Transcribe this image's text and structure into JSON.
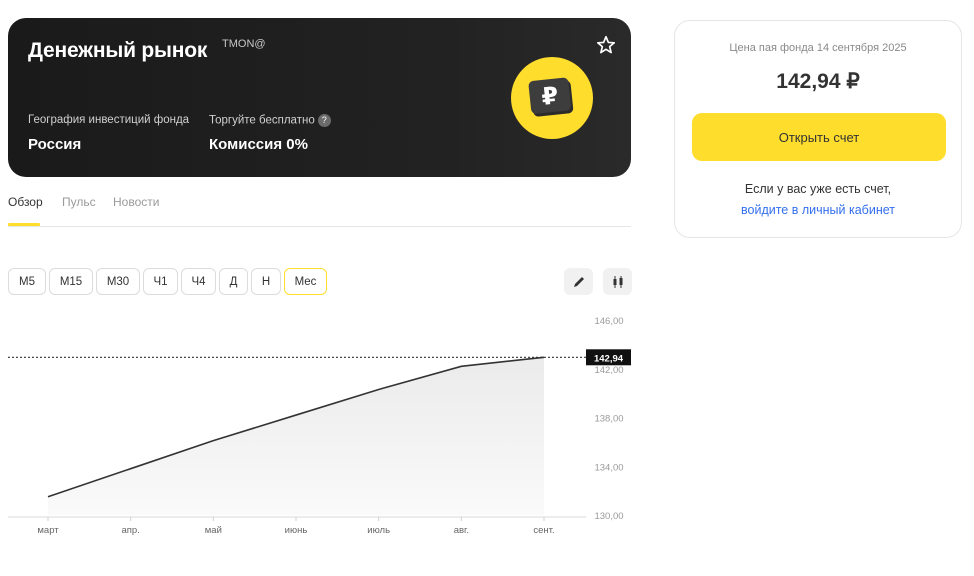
{
  "fund": {
    "title": "Денежный рынок",
    "ticker": "TMON@",
    "geo_label": "География инвестиций фонда",
    "geo_value": "Россия",
    "trade_label": "Торгуйте бесплатно",
    "trade_value": "Комиссия 0%",
    "help_symbol": "?"
  },
  "tabs": [
    "Обзор",
    "Пульс",
    "Новости"
  ],
  "periods": [
    "M5",
    "M15",
    "M30",
    "Ч1",
    "Ч4",
    "Д",
    "Н",
    "Мес"
  ],
  "active_period": "Мес",
  "tools": [
    "draw-icon",
    "candles-icon"
  ],
  "price_card": {
    "date_label": "Цена пая фонда 14 сентября 2025",
    "price": "142,94 ₽",
    "open_button": "Открыть счет",
    "note": "Если у вас уже есть счет,",
    "link": "войдите в личный кабинет"
  },
  "colors": {
    "accent": "#ffdd2d",
    "link": "#336fee",
    "hero_bg": "#1d1d1f"
  },
  "chart_data": {
    "type": "area",
    "categories": [
      "март",
      "апр.",
      "май",
      "июнь",
      "июль",
      "авг.",
      "сент."
    ],
    "values": [
      131.5,
      133.8,
      136.1,
      138.2,
      140.3,
      142.2,
      142.94
    ],
    "y_ticks": [
      "146,00",
      "142,00",
      "138,00",
      "134,00",
      "130,00"
    ],
    "ylim": [
      130,
      146
    ],
    "current_value": 142.94,
    "current_label": "142,94"
  }
}
